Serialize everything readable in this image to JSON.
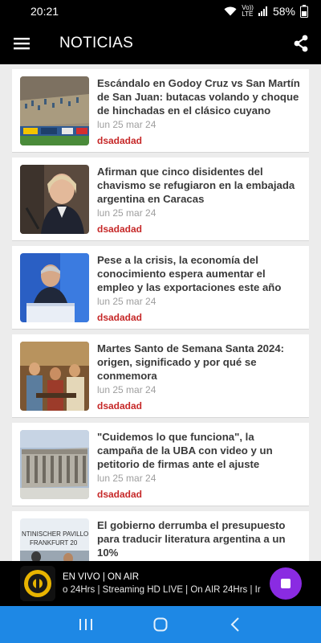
{
  "status_bar": {
    "time": "20:21",
    "net_top": "Vo))",
    "net_bottom": "LTE",
    "battery": "58%"
  },
  "app_bar": {
    "title": "NOTICIAS"
  },
  "news": [
    {
      "headline": "Escándalo en Godoy Cruz vs San Martín de San Juan: butacas volando y choque de hinchadas en el clásico cuyano",
      "date": "lun 25 mar 24",
      "source": "dsadadad",
      "thumb": "stadium-photo"
    },
    {
      "headline": "Afirman que cinco disidentes del chavismo se refugiaron en la embajada argentina en Caracas",
      "date": "lun 25 mar 24",
      "source": "dsadadad",
      "thumb": "woman-speaking-photo"
    },
    {
      "headline": "Pese a la crisis, la economía del conocimiento espera aumentar el empleo y las exportaciones este año",
      "date": "lun 25 mar 24",
      "source": "dsadadad",
      "thumb": "man-podium-photo"
    },
    {
      "headline": "Martes Santo de Semana Santa 2024: origen, significado y por qué se conmemora",
      "date": "lun 25 mar 24",
      "source": "dsadadad",
      "thumb": "painting-photo"
    },
    {
      "headline": "\"Cuidemos lo que funciona\", la campaña de la UBA con video y un petitorio de firmas ante el ajuste",
      "date": "lun 25 mar 24",
      "source": "dsadadad",
      "thumb": "university-building-photo"
    },
    {
      "headline": "El gobierno derrumba el presupuesto para traducir literatura argentina a un 10%",
      "date": "",
      "source": "",
      "thumb": "book-fair-photo",
      "thumb_text_1": "NTINISCHER PAVILLO",
      "thumb_text_2": "FRANKFURT 20"
    }
  ],
  "player": {
    "title": "EN VIVO | ON AIR",
    "subtitle": "o 24Hrs | Streaming HD LIVE | On AIR 24Hrs | Ir"
  },
  "colors": {
    "accent_red": "#c62828",
    "player_button": "#8a2be2",
    "nav_bar": "#1e88e5"
  }
}
